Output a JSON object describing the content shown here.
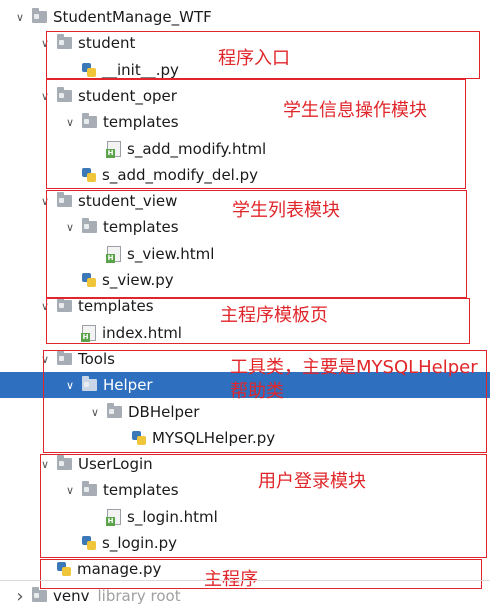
{
  "tree": [
    {
      "label": "StudentManage_WTF",
      "icon": "folder-icon",
      "arrow": "expanded",
      "depth": 0
    },
    {
      "label": "student",
      "icon": "folder-icon",
      "arrow": "expanded",
      "depth": 1
    },
    {
      "label": "__init__.py",
      "icon": "python-file-icon",
      "arrow": "none",
      "depth": 2
    },
    {
      "label": "student_oper",
      "icon": "folder-icon",
      "arrow": "expanded",
      "depth": 1
    },
    {
      "label": "templates",
      "icon": "folder-icon",
      "arrow": "expanded",
      "depth": 2
    },
    {
      "label": "s_add_modify.html",
      "icon": "html-file-icon",
      "arrow": "none",
      "depth": 3
    },
    {
      "label": "s_add_modify_del.py",
      "icon": "python-file-icon",
      "arrow": "none",
      "depth": 2
    },
    {
      "label": "student_view",
      "icon": "folder-icon",
      "arrow": "expanded",
      "depth": 1
    },
    {
      "label": "templates",
      "icon": "folder-icon",
      "arrow": "expanded",
      "depth": 2
    },
    {
      "label": "s_view.html",
      "icon": "html-file-icon",
      "arrow": "none",
      "depth": 3
    },
    {
      "label": "s_view.py",
      "icon": "python-file-icon",
      "arrow": "none",
      "depth": 2
    },
    {
      "label": "templates",
      "icon": "folder-icon",
      "arrow": "expanded",
      "depth": 1
    },
    {
      "label": "index.html",
      "icon": "html-file-icon",
      "arrow": "none",
      "depth": 2
    },
    {
      "label": "Tools",
      "icon": "folder-icon",
      "arrow": "expanded",
      "depth": 1
    },
    {
      "label": "Helper",
      "icon": "folder-icon",
      "arrow": "expanded",
      "depth": 2,
      "selected": true
    },
    {
      "label": "DBHelper",
      "icon": "folder-icon",
      "arrow": "expanded",
      "depth": 3
    },
    {
      "label": "MYSQLHelper.py",
      "icon": "python-file-icon",
      "arrow": "none",
      "depth": 4
    },
    {
      "label": "UserLogin",
      "icon": "folder-icon",
      "arrow": "expanded",
      "depth": 1
    },
    {
      "label": "templates",
      "icon": "folder-icon",
      "arrow": "expanded",
      "depth": 2
    },
    {
      "label": "s_login.html",
      "icon": "html-file-icon",
      "arrow": "none",
      "depth": 3
    },
    {
      "label": "s_login.py",
      "icon": "python-file-icon",
      "arrow": "none",
      "depth": 2
    },
    {
      "label": "manage.py",
      "icon": "python-file-icon",
      "arrow": "none",
      "depth": 1
    },
    {
      "label": "venv",
      "icon": "folder-icon",
      "arrow": "collapsed",
      "depth": 0,
      "suffix": "library root"
    }
  ],
  "annotations": [
    "程序入口",
    "学生信息操作模块",
    "学生列表模块",
    "主程序模板页",
    "工具类，主要是MYSQLHelper帮助类",
    "用户登录模块",
    "主程序"
  ],
  "colors": {
    "annotation": "#e0262a",
    "selection": "#2f6fbf",
    "folder": "#a6adb5"
  }
}
